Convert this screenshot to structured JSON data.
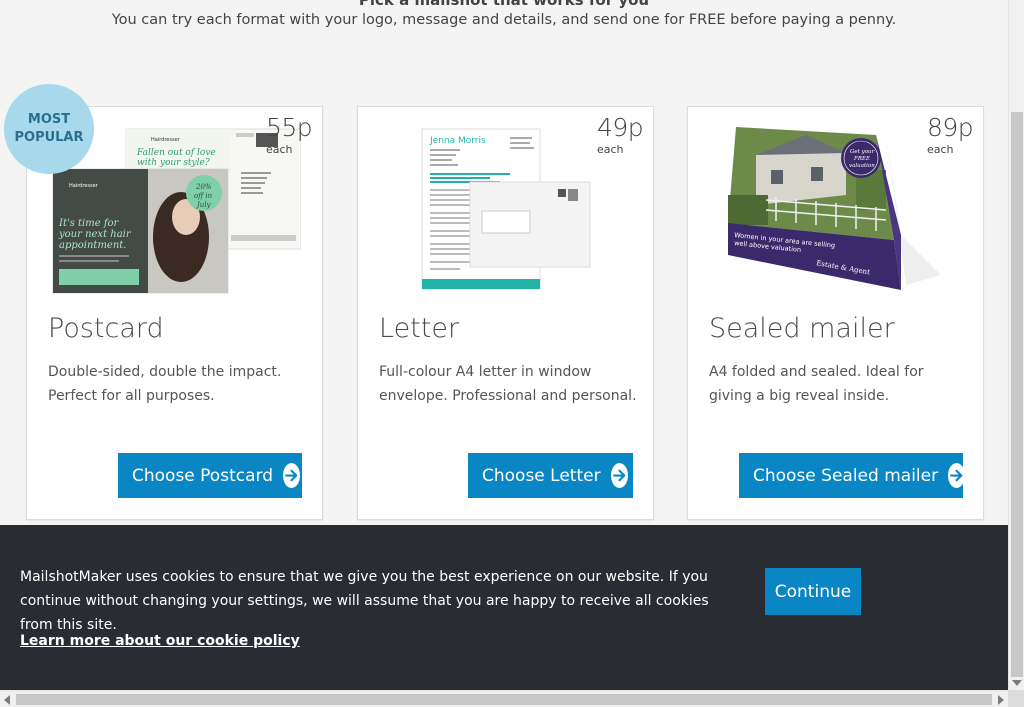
{
  "header": {
    "heading": "Pick a mailshot that works for you",
    "subtitle": "You can try each format with your logo, message and details, and send one for FREE before paying a penny."
  },
  "badge": {
    "line1": "MOST",
    "line2": "POPULAR"
  },
  "cards": [
    {
      "title": "Postcard",
      "price": "55p",
      "each": "each",
      "description": "Double-sided, double the impact. Perfect for all purposes.",
      "button": "Choose Postcard",
      "image": {
        "brand": "Hairdresser",
        "front_tagline": "Fallen out of love with your style?",
        "back_tagline": "It's time for your next hair appointment.",
        "offer": "20% off in July"
      }
    },
    {
      "title": "Letter",
      "price": "49p",
      "each": "each",
      "description": "Full-colour A4 letter in window envelope. Professional and personal.",
      "button": "Choose Letter",
      "image": {
        "sender": "Jenna Morris"
      }
    },
    {
      "title": "Sealed mailer",
      "price": "89p",
      "each": "each",
      "description": "A4 folded and sealed. Ideal for giving a big reveal inside.",
      "button": "Choose Sealed mailer",
      "image": {
        "seal": "Get your FREE valuation",
        "banner": "Women in your area are selling well above valuation",
        "brand": "Estate & Agent"
      }
    }
  ],
  "cookie": {
    "message": "MailshotMaker uses cookies to ensure that we give you the best experience on our website. If you continue without changing your settings, we will assume that you are happy to receive all cookies from this site.",
    "policy_link": "Learn more about our cookie policy",
    "continue": "Continue"
  },
  "colors": {
    "accent": "#0a86c4",
    "cookie_bg": "#292c33",
    "badge": "#a8d8ec",
    "letter_teal": "#22b3a6",
    "mailer_purple": "#3b2a6b"
  }
}
